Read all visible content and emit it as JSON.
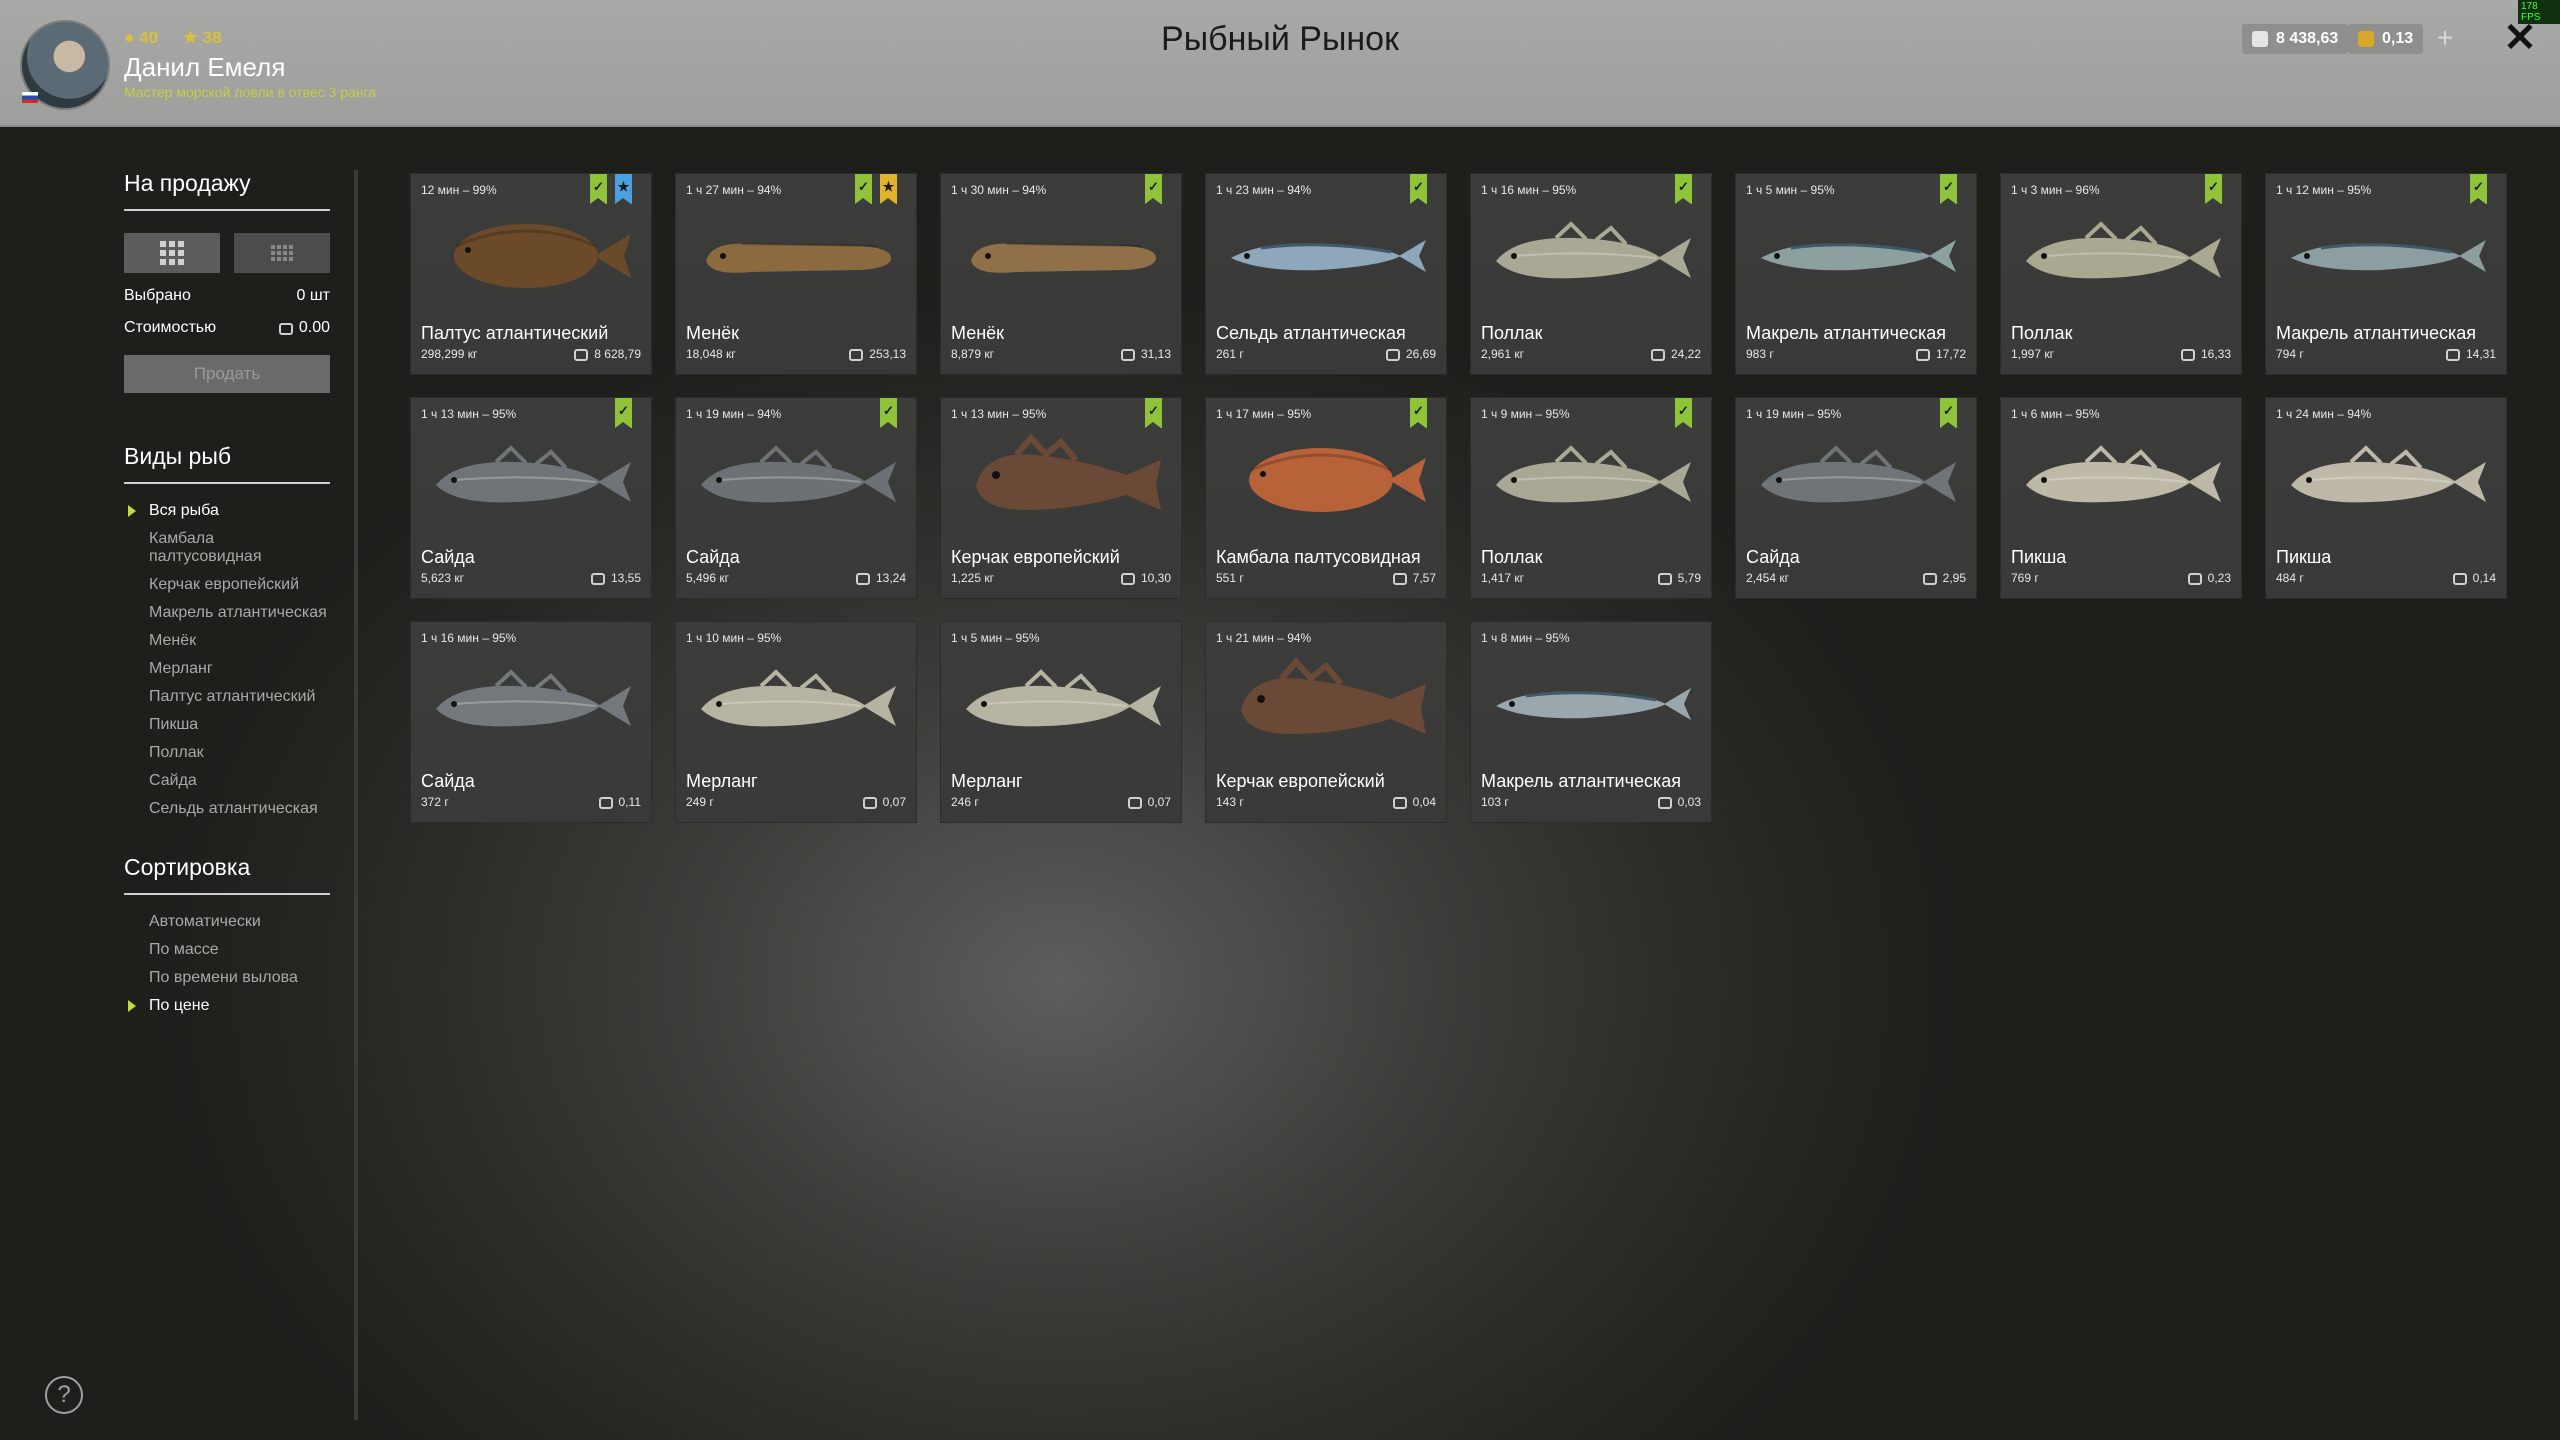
{
  "header": {
    "title": "Рыбный Рынок",
    "player_level": "40",
    "player_stars": "38",
    "player_name": "Данил Емеля",
    "player_rank": "Мастер морской ловли в отвес 3 ранга",
    "silver": "8 438,63",
    "gold": "0,13",
    "fps": "178 FPS"
  },
  "sidebar": {
    "sale_title": "На продажу",
    "selected_label": "Выбрано",
    "selected_value": "0 шт",
    "cost_label": "Стоимостью",
    "cost_value": "0.00",
    "sell_button": "Продать",
    "species_title": "Виды рыб",
    "species": [
      {
        "label": "Вся рыба",
        "active": true
      },
      {
        "label": "Камбала палтусовидная",
        "active": false
      },
      {
        "label": "Керчак европейский",
        "active": false
      },
      {
        "label": "Макрель атлантическая",
        "active": false
      },
      {
        "label": "Менёк",
        "active": false
      },
      {
        "label": "Мерланг",
        "active": false
      },
      {
        "label": "Палтус атлантический",
        "active": false
      },
      {
        "label": "Пикша",
        "active": false
      },
      {
        "label": "Поллак",
        "active": false
      },
      {
        "label": "Сайда",
        "active": false
      },
      {
        "label": "Сельдь атлантическая",
        "active": false
      }
    ],
    "sort_title": "Сортировка",
    "sort": [
      {
        "label": "Автоматически",
        "active": false
      },
      {
        "label": "По массе",
        "active": false
      },
      {
        "label": "По времени вылова",
        "active": false
      },
      {
        "label": "По цене",
        "active": true
      }
    ]
  },
  "fish": [
    {
      "time": "12 мин – 99%",
      "name": "Палтус атлантический",
      "weight": "298,299 кг",
      "price": "8 628,79",
      "badges": [
        "green",
        "blue"
      ],
      "kind": "flat",
      "color": "#6b4a2a"
    },
    {
      "time": "1 ч 27 мин – 94%",
      "name": "Менёк",
      "weight": "18,048 кг",
      "price": "253,13",
      "badges": [
        "green",
        "gold"
      ],
      "kind": "eel",
      "color": "#8a6a3e"
    },
    {
      "time": "1 ч 30 мин – 94%",
      "name": "Менёк",
      "weight": "8,879 кг",
      "price": "31,13",
      "badges": [
        "green"
      ],
      "kind": "eel",
      "color": "#8f7048"
    },
    {
      "time": "1 ч 23 мин – 94%",
      "name": "Сельдь атлантическая",
      "weight": "261 г",
      "price": "26,69",
      "badges": [
        "green"
      ],
      "kind": "slim",
      "color": "#8fa7bb"
    },
    {
      "time": "1 ч 16 мин – 95%",
      "name": "Поллак",
      "weight": "2,961 кг",
      "price": "24,22",
      "badges": [
        "green"
      ],
      "kind": "cod",
      "color": "#a9a894"
    },
    {
      "time": "1 ч 5 мин – 95%",
      "name": "Макрель атлантическая",
      "weight": "983 г",
      "price": "17,72",
      "badges": [
        "green"
      ],
      "kind": "slim",
      "color": "#8da0a0"
    },
    {
      "time": "1 ч 3 мин – 96%",
      "name": "Поллак",
      "weight": "1,997 кг",
      "price": "16,33",
      "badges": [
        "green"
      ],
      "kind": "cod",
      "color": "#aaa890"
    },
    {
      "time": "1 ч 12 мин – 95%",
      "name": "Макрель атлантическая",
      "weight": "794 г",
      "price": "14,31",
      "badges": [
        "green"
      ],
      "kind": "slim",
      "color": "#8c9ea0"
    },
    {
      "time": "1 ч 13 мин – 95%",
      "name": "Сайда",
      "weight": "5,623 кг",
      "price": "13,55",
      "badges": [
        "green"
      ],
      "kind": "cod",
      "color": "#6f7478"
    },
    {
      "time": "1 ч 19 мин – 94%",
      "name": "Сайда",
      "weight": "5,496 кг",
      "price": "13,24",
      "badges": [
        "green"
      ],
      "kind": "cod",
      "color": "#6c7175"
    },
    {
      "time": "1 ч 13 мин – 95%",
      "name": "Керчак европейский",
      "weight": "1,225 кг",
      "price": "10,30",
      "badges": [
        "green"
      ],
      "kind": "sculpin",
      "color": "#6a4a36"
    },
    {
      "time": "1 ч 17 мин – 95%",
      "name": "Камбала палтусовидная",
      "weight": "551 г",
      "price": "7,57",
      "badges": [
        "green"
      ],
      "kind": "flat",
      "color": "#b8623a"
    },
    {
      "time": "1 ч 9 мин – 95%",
      "name": "Поллак",
      "weight": "1,417 кг",
      "price": "5,79",
      "badges": [
        "green"
      ],
      "kind": "cod",
      "color": "#a9a894"
    },
    {
      "time": "1 ч 19 мин – 95%",
      "name": "Сайда",
      "weight": "2,454 кг",
      "price": "2,95",
      "badges": [
        "green"
      ],
      "kind": "cod",
      "color": "#6f7478"
    },
    {
      "time": "1 ч 6 мин – 95%",
      "name": "Пикша",
      "weight": "769 г",
      "price": "0,23",
      "badges": [],
      "kind": "cod",
      "color": "#bdb8a8"
    },
    {
      "time": "1 ч 24 мин – 94%",
      "name": "Пикша",
      "weight": "484 г",
      "price": "0,14",
      "badges": [],
      "kind": "cod",
      "color": "#bdb8a8"
    },
    {
      "time": "1 ч 16 мин – 95%",
      "name": "Сайда",
      "weight": "372 г",
      "price": "0,11",
      "badges": [],
      "kind": "cod",
      "color": "#73787c"
    },
    {
      "time": "1 ч 10 мин – 95%",
      "name": "Мерланг",
      "weight": "249 г",
      "price": "0,07",
      "badges": [],
      "kind": "cod",
      "color": "#b7b3a2"
    },
    {
      "time": "1 ч 5 мин – 95%",
      "name": "Мерланг",
      "weight": "246 г",
      "price": "0,07",
      "badges": [],
      "kind": "cod",
      "color": "#b7b3a2"
    },
    {
      "time": "1 ч 21 мин – 94%",
      "name": "Керчак европейский",
      "weight": "143 г",
      "price": "0,04",
      "badges": [],
      "kind": "sculpin",
      "color": "#6a4a36"
    },
    {
      "time": "1 ч 8 мин – 95%",
      "name": "Макрель атлантическая",
      "weight": "103 г",
      "price": "0,03",
      "badges": [],
      "kind": "slim",
      "color": "#9aa8ad"
    }
  ]
}
